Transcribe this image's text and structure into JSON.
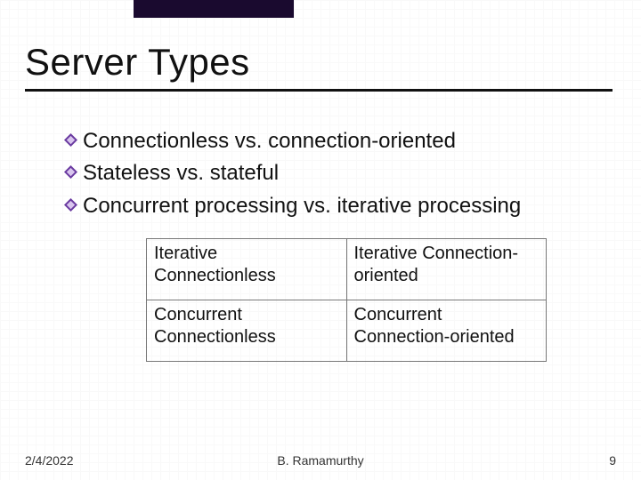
{
  "colors": {
    "accent_bar": "#1a0a2f",
    "bullet_outer": "#6a3aa0",
    "bullet_inner": "#d9c6ee"
  },
  "title": "Server Types",
  "bullets": [
    "Connectionless vs. connection-oriented",
    "Stateless vs. stateful",
    "Concurrent processing vs. iterative processing"
  ],
  "table": {
    "rows": [
      [
        "Iterative Connectionless",
        "Iterative Connection-oriented"
      ],
      [
        "Concurrent Connectionless",
        "Concurrent Connection-oriented"
      ]
    ]
  },
  "footer": {
    "date": "2/4/2022",
    "author": "B. Ramamurthy",
    "page": "9"
  }
}
